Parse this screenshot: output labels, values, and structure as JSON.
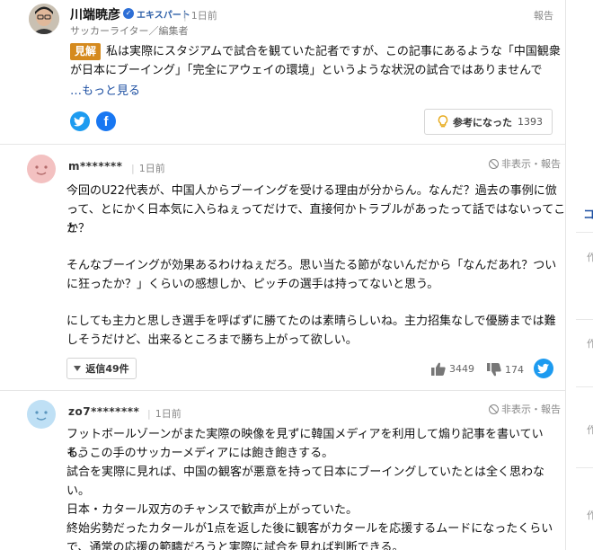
{
  "expert_comment": {
    "name": "川端暁彦",
    "badge": "エキスパート",
    "time": "1日前",
    "role": "サッカーライター／編集者",
    "report": "報告",
    "tag": "見解",
    "body_line1": "私は実際にスタジアムで試合を観ていた記者ですが、この記事にあるような「中国観衆",
    "body_line2": "が日本にブーイング」「完全にアウェイの環境」というような状況の試合ではありませんで",
    "more": "…もっと見る",
    "helpful_label": "参考になった",
    "helpful_count": "1393"
  },
  "comments": [
    {
      "user": "m*******",
      "time": "1日前",
      "hide_report": "非表示・報告",
      "paragraphs": [
        [
          "今回のU22代表が、中国人からブーイングを受ける理由が分からん。なんだ？過去の事例に倣",
          "って、とにかく日本気に入らねぇってだけで、直接何かトラブルがあったって話ではないってこと",
          "か？"
        ],
        [
          "そんなブーイングが効果あるわけねぇだろ。思い当たる節がないんだから「なんだあれ？つい",
          "に狂ったか？」くらいの感想しか、ピッチの選手は持ってないと思う。"
        ],
        [
          "にしても主力と思しき選手を呼ばずに勝てたのは素晴らしいね。主力招集なしで優勝までは難",
          "しそうだけど、出来るところまで勝ち上がって欲しい。"
        ]
      ],
      "reply_label": "返信",
      "reply_count": "49件",
      "likes": "3449",
      "dislikes": "174"
    },
    {
      "user": "zo7********",
      "time": "1日前",
      "hide_report": "非表示・報告",
      "lines": [
        "フットボールゾーンがまた実際の映像を見ずに韓国メディアを利用して煽り記事を書いている。",
        "もうこの手のサッカーメディアには飽き飽きする。",
        "試合を実際に見れば、中国の観客が悪意を持って日本にブーイングしていたとは全く思わな",
        "い。",
        "日本・カタール双方のチャンスで歓声が上がっていた。",
        "終始劣勢だったカタールが1点を返した後に観客がカタールを応援するムードになったくらい",
        "で、通常の応援の範疇だろうと実際に試合を見れば判断できる。"
      ]
    }
  ],
  "right_column": {
    "link": "コ",
    "small1": "作",
    "small2": "作",
    "small3": "作",
    "small4": "作"
  },
  "colors": {
    "accent_link": "#1e50a2",
    "tag_bg": "#d58a1e",
    "twitter": "#1d9bf0",
    "facebook": "#1877f2"
  }
}
